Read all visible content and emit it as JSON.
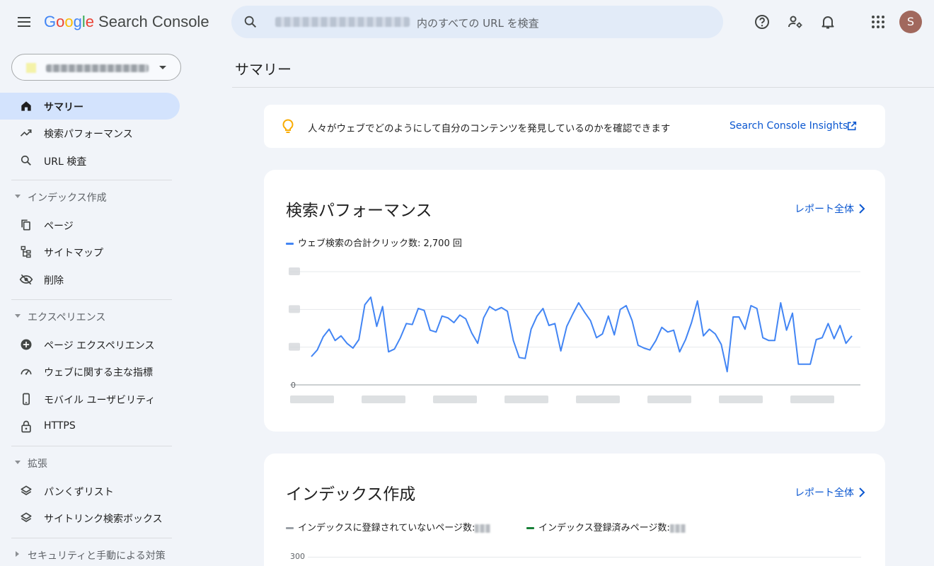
{
  "header": {
    "logo": {
      "g1": "G",
      "o1": "o",
      "o2": "o",
      "g2": "g",
      "l": "l",
      "e": "e",
      "product": "Search Console"
    },
    "search_placeholder": "内のすべての URL を検査",
    "avatar_initial": "S"
  },
  "sidebar": {
    "items": [
      {
        "label": "サマリー"
      },
      {
        "label": "検索パフォーマンス"
      },
      {
        "label": "URL 検査"
      }
    ],
    "sections": [
      {
        "label": "インデックス作成",
        "items": [
          {
            "label": "ページ"
          },
          {
            "label": "サイトマップ"
          },
          {
            "label": "削除"
          }
        ]
      },
      {
        "label": "エクスペリエンス",
        "items": [
          {
            "label": "ページ エクスペリエンス"
          },
          {
            "label": "ウェブに関する主な指標"
          },
          {
            "label": "モバイル ユーザビリティ"
          },
          {
            "label": "HTTPS"
          }
        ]
      },
      {
        "label": "拡張",
        "items": [
          {
            "label": "パンくずリスト"
          },
          {
            "label": "サイトリンク検索ボックス"
          }
        ]
      },
      {
        "label": "セキュリティと手動による対策"
      }
    ]
  },
  "main": {
    "page_title": "サマリー",
    "insights": {
      "message": "人々がウェブでどのようにして自分のコンテンツを発見しているのかを確認できます",
      "link": "Search Console Insights"
    },
    "performance": {
      "title": "検索パフォーマンス",
      "report_link": "レポート全体",
      "legend": "ウェブ検索の合計クリック数: 2,700 回"
    },
    "indexing": {
      "title": "インデックス作成",
      "report_link": "レポート全体",
      "legend_not_indexed": "インデックスに登録されていないページ数:",
      "legend_indexed": "インデックス登録済みページ数:"
    }
  },
  "colors": {
    "accent": "#0b57d0",
    "active_nav": "#d3e3fd",
    "series_clicks": "#4285f4",
    "series_indexed": "#188038",
    "series_not_indexed": "#9aa0a6"
  },
  "chart_data": [
    {
      "type": "line",
      "xlabel": "",
      "ylabel": "",
      "y_tick_labels": [
        "0"
      ],
      "ylim": [
        0,
        120
      ],
      "grid": true,
      "legend": "top-left",
      "series": [
        {
          "name": "ウェブ検索の合計クリック数: 2,700 回",
          "values": [
            30,
            37,
            51,
            59,
            47,
            52,
            44,
            39,
            48,
            85,
            93,
            62,
            83,
            35,
            38,
            50,
            65,
            64,
            81,
            79,
            58,
            56,
            73,
            71,
            66,
            74,
            70,
            55,
            44,
            71,
            83,
            79,
            82,
            78,
            47,
            29,
            28,
            59,
            73,
            81,
            63,
            65,
            36,
            62,
            75,
            87,
            77,
            68,
            50,
            54,
            73,
            53,
            80,
            84,
            68,
            42,
            39,
            37,
            47,
            61,
            56,
            58,
            35,
            48,
            66,
            89,
            52,
            59,
            54,
            43,
            14,
            72,
            72,
            59,
            84,
            81,
            50,
            47,
            47,
            87,
            58,
            76,
            22,
            22,
            22,
            48,
            50,
            65,
            49,
            63,
            44,
            52
          ]
        }
      ]
    },
    {
      "type": "line",
      "y_tick_labels": [
        "300"
      ],
      "series": [
        {
          "name": "インデックスに登録されていないページ数:",
          "values": []
        },
        {
          "name": "インデックス登録済みページ数:",
          "values": []
        }
      ]
    }
  ]
}
